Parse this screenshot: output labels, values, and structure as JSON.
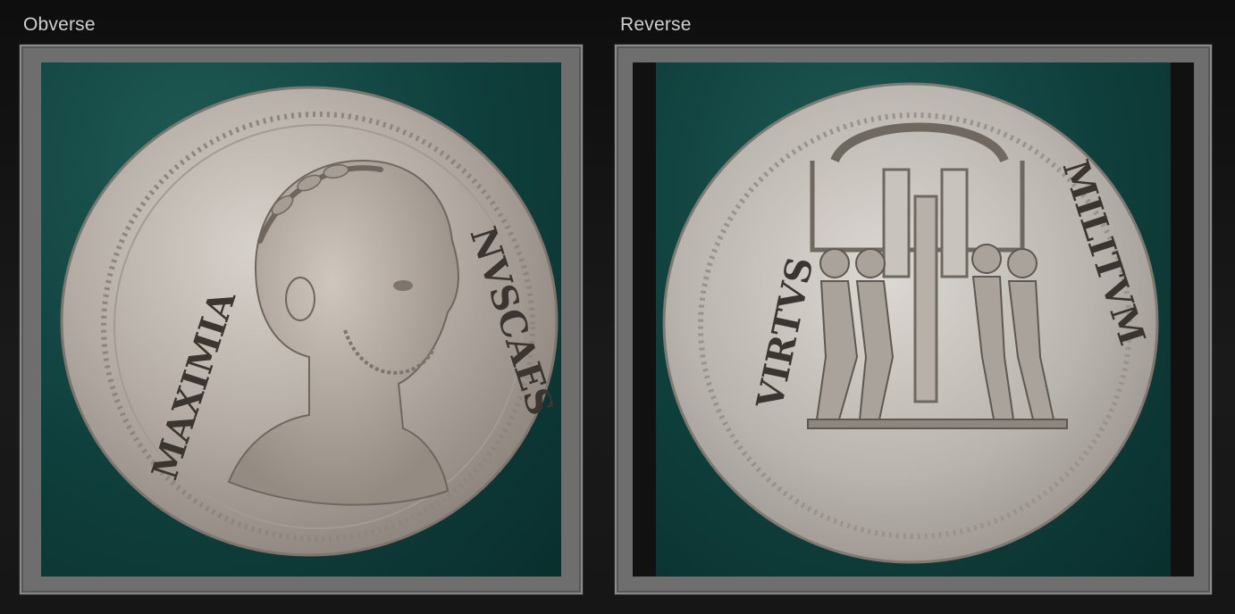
{
  "panels": {
    "obverse": {
      "label": "Obverse",
      "legend_left": "MAXIMIA",
      "legend_right": "NVSCAES"
    },
    "reverse": {
      "label": "Reverse",
      "legend_left": "VIRTVS",
      "legend_right": "MILITVM"
    }
  },
  "colors": {
    "background": "#121212",
    "frame": "#6e6e6e",
    "felt": "#0f3f3c",
    "silver": "#b9b3ad"
  }
}
